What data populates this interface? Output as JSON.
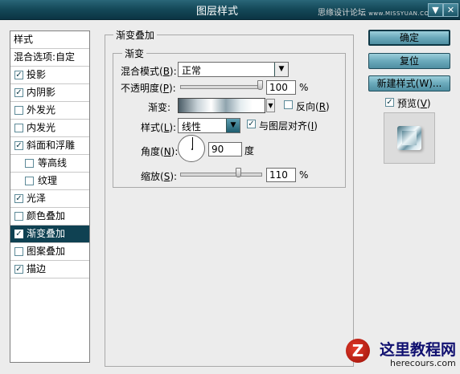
{
  "window": {
    "title": "图层样式",
    "top_watermark": "思缘设计论坛",
    "top_watermark_url": "www.MISSYUAN.COM",
    "buttons": {
      "minimize": "▼",
      "close": "✕"
    }
  },
  "left_panel": {
    "header": "样式",
    "blend_options": "混合选项:自定",
    "items": [
      {
        "label": "投影",
        "checked": true,
        "indent": false,
        "selected": false
      },
      {
        "label": "内阴影",
        "checked": true,
        "indent": false,
        "selected": false
      },
      {
        "label": "外发光",
        "checked": false,
        "indent": false,
        "selected": false
      },
      {
        "label": "内发光",
        "checked": false,
        "indent": false,
        "selected": false
      },
      {
        "label": "斜面和浮雕",
        "checked": true,
        "indent": false,
        "selected": false
      },
      {
        "label": "等高线",
        "checked": false,
        "indent": true,
        "selected": false
      },
      {
        "label": "纹理",
        "checked": false,
        "indent": true,
        "selected": false
      },
      {
        "label": "光泽",
        "checked": true,
        "indent": false,
        "selected": false
      },
      {
        "label": "颜色叠加",
        "checked": false,
        "indent": false,
        "selected": false
      },
      {
        "label": "渐变叠加",
        "checked": true,
        "indent": false,
        "selected": true
      },
      {
        "label": "图案叠加",
        "checked": false,
        "indent": false,
        "selected": false
      },
      {
        "label": "描边",
        "checked": true,
        "indent": false,
        "selected": false
      }
    ]
  },
  "gradient_overlay": {
    "outer_title": "渐变叠加",
    "inner_title": "渐变",
    "blend_mode": {
      "label": "混合模式(",
      "key": "B",
      "end": "):",
      "value": "正常"
    },
    "opacity": {
      "label": "不透明度(",
      "key": "P",
      "end": "):",
      "value": "100",
      "unit": "%",
      "level": 1.0
    },
    "gradient": {
      "label": "渐变:",
      "reverse_label": "反向(",
      "reverse_key": "R",
      "reverse_end": ")",
      "reverse_checked": false
    },
    "style": {
      "label": "样式(",
      "key": "L",
      "end": "):",
      "value": "线性",
      "align_label": "与图层对齐(",
      "align_key": "I",
      "align_end": ")",
      "align_checked": true
    },
    "angle": {
      "label": "角度(",
      "key": "N",
      "end": "):",
      "value": "90",
      "unit": "度",
      "degrees": 90
    },
    "scale": {
      "label": "缩放(",
      "key": "S",
      "end": "):",
      "value": "110",
      "unit": "%",
      "level": 0.73
    }
  },
  "right_panel": {
    "ok": "确定",
    "reset": "复位",
    "new_style": "新建样式(W)...",
    "preview": {
      "label": "预览(",
      "key": "V",
      "end": ")",
      "checked": true
    }
  },
  "site_watermark": {
    "logo_letter": "Z",
    "name": "这里教程网",
    "url": "herecours.com"
  }
}
